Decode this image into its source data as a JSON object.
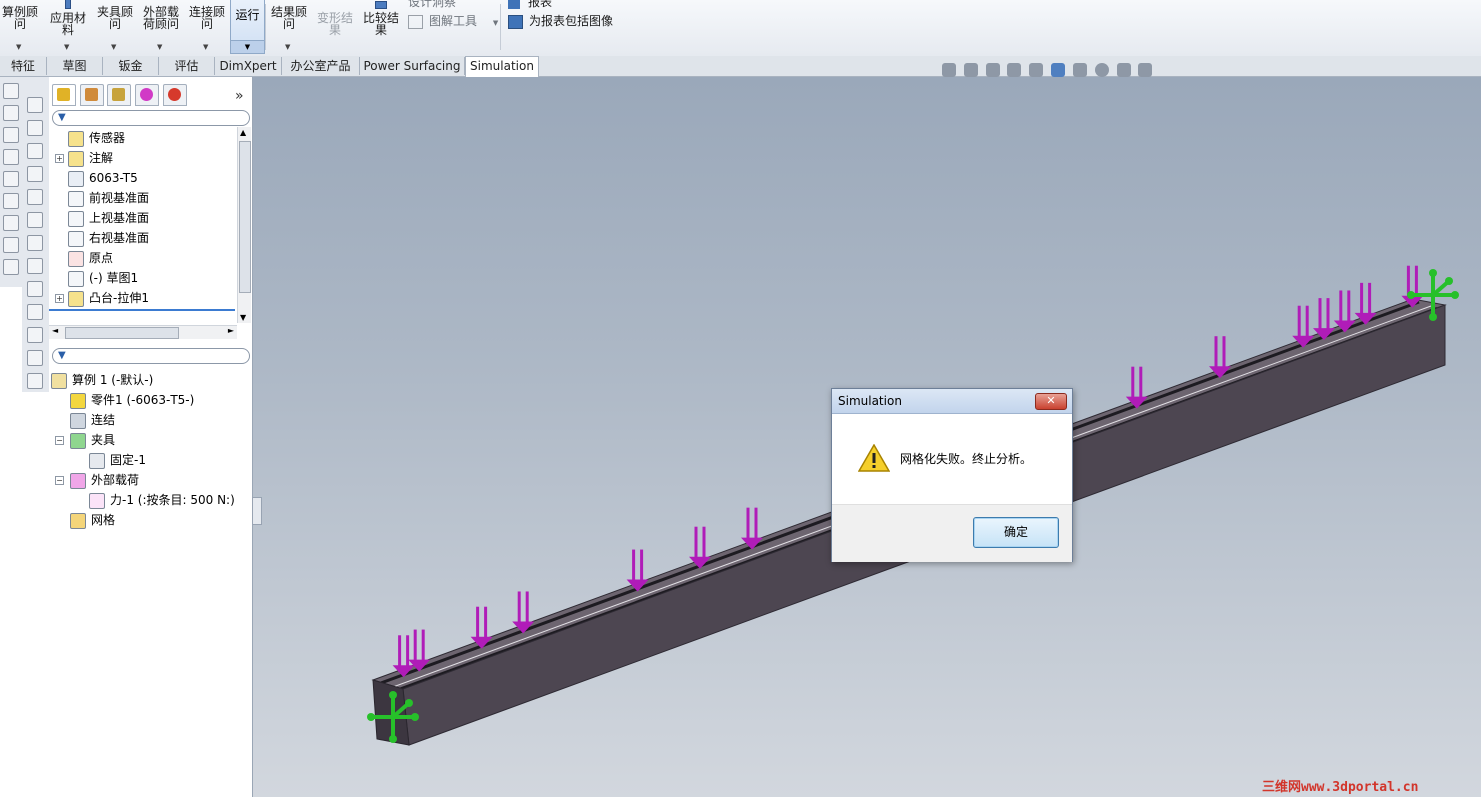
{
  "ribbon": {
    "study_advisor": "算例顾\n问",
    "apply_material": "应用材\n料",
    "fixtures_advisor": "夹具顾\n问",
    "external_loads_advisor": "外部载\n荷顾问",
    "connections_advisor": "连接顾\n问",
    "run": "运行",
    "results_advisor": "结果顾\n问",
    "deformed_result": "变形结\n果",
    "compare_results": "比较结\n果",
    "design_insight": "设计洞察",
    "plot_tools": "图解工具",
    "report": "报表",
    "include_image": "为报表包括图像"
  },
  "tabs": [
    "特征",
    "草图",
    "钣金",
    "评估",
    "DimXpert",
    "办公室产品",
    "Power Surfacing",
    "Simulation"
  ],
  "active_tab": "Simulation",
  "feature_tree": [
    {
      "label": "传感器",
      "icon": "sensor-icon",
      "expand": false
    },
    {
      "label": "注解",
      "icon": "annotation-icon",
      "expand": true
    },
    {
      "label": "6063-T5",
      "icon": "material-icon",
      "expand": false
    },
    {
      "label": "前视基准面",
      "icon": "plane-icon",
      "expand": false
    },
    {
      "label": "上视基准面",
      "icon": "plane-icon",
      "expand": false
    },
    {
      "label": "右视基准面",
      "icon": "plane-icon",
      "expand": false
    },
    {
      "label": "原点",
      "icon": "origin-icon",
      "expand": false
    },
    {
      "label": "(-) 草图1",
      "icon": "sketch-icon",
      "expand": false
    },
    {
      "label": "凸台-拉伸1",
      "icon": "extrude-icon",
      "expand": true
    }
  ],
  "study_tree": {
    "root": "算例 1 (-默认-)",
    "items": [
      {
        "label": "零件1 (-6063-T5-)",
        "icon": "part-icon",
        "level": 1,
        "expand": false
      },
      {
        "label": "连结",
        "icon": "connections-icon",
        "level": 1,
        "expand": false
      },
      {
        "label": "夹具",
        "icon": "fixtures-icon",
        "level": 1,
        "expand": true
      },
      {
        "label": "固定-1",
        "icon": "fixed-icon",
        "level": 2,
        "expand": false
      },
      {
        "label": "外部载荷",
        "icon": "external-load-icon",
        "level": 1,
        "expand": true
      },
      {
        "label": "力-1 (:按条目: 500 N:)",
        "icon": "force-icon",
        "level": 2,
        "expand": false
      },
      {
        "label": "网格",
        "icon": "mesh-icon",
        "level": 1,
        "expand": false
      }
    ]
  },
  "dialog": {
    "title": "Simulation",
    "message": "网格化失败。终止分析。",
    "ok_label": "确定",
    "close_glyph": "✕"
  },
  "watermark": "三维网www.3dportal.cn",
  "colors": {
    "load_arrow": "#b01cb8",
    "fixture_arrow": "#27c02a",
    "beam": "#4d4651",
    "viewport_top": "#9aa8ba"
  }
}
